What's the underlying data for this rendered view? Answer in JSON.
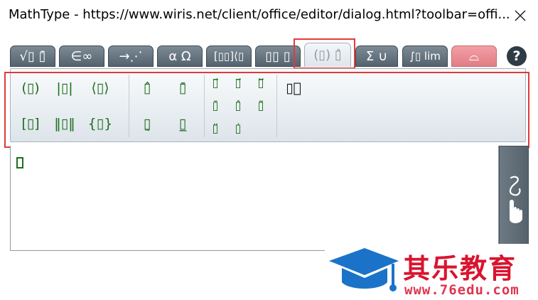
{
  "window": {
    "title": "MathType - https://www.wiris.net/client/office/editor/dialog.html?toolbar=offi..."
  },
  "tabs": [
    {
      "name": "general",
      "label": "√▯ ▯̄"
    },
    {
      "name": "symbols",
      "label": "∈∞"
    },
    {
      "name": "arrows",
      "label": "→⋰"
    },
    {
      "name": "greek",
      "label": "α Ω"
    },
    {
      "name": "matrices",
      "label": "[▯▯]⟨▯"
    },
    {
      "name": "scripts",
      "label": "▯▯ ▯"
    },
    {
      "name": "decorations",
      "label": "(▯) ▯̂",
      "active": true
    },
    {
      "name": "big-operators",
      "label": "Σ ∪"
    },
    {
      "name": "calculus",
      "label": "∫▯ lim"
    },
    {
      "name": "chemistry",
      "label": "⌓"
    }
  ],
  "help_label": "?",
  "symbols": {
    "group1": [
      "(▯)",
      "|▯|",
      "⟨▯⟩",
      "[▯]",
      "‖▯‖",
      "{▯}"
    ],
    "group2": [
      "▯̂",
      "▯̄",
      "▯̰",
      "▯̲"
    ],
    "group3": [
      "▯⃗",
      "▯⃗",
      "▯⃡",
      "▯̄",
      "▯̂",
      "▯̃",
      "▯̈",
      "▯̇"
    ],
    "group4": [
      "▯⃞"
    ]
  },
  "editor": {
    "content": ""
  },
  "watermark": {
    "title": "其乐教育",
    "url": "www.76edu.com"
  },
  "colors": {
    "tab_dark": "#55636e",
    "symbol_green": "#1d6e1d",
    "highlight_red": "#e23a3a",
    "watermark_red": "#d9142f",
    "watermark_blue": "#1a73c9"
  }
}
